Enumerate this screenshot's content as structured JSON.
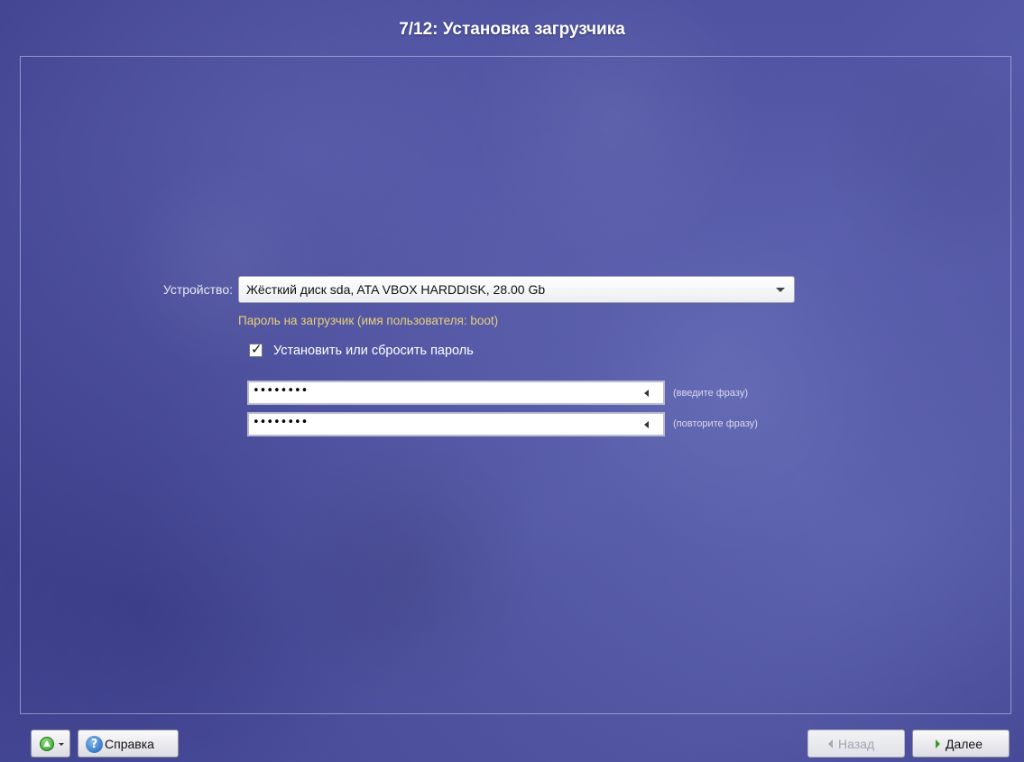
{
  "window": {
    "title": "7/12: Установка загрузчика"
  },
  "device": {
    "label": "Устройство:",
    "selected": "Жёсткий диск sda, ATA VBOX HARDDISK, 28.00 Gb"
  },
  "bootloader_password": {
    "section_label": "Пароль на загрузчик (имя пользователя: boot)",
    "checkbox_label": "Установить или сбросить пароль",
    "checkbox_checked": true,
    "checkbox_mark": "✓",
    "password_value": "••••••••",
    "password_hint": "(введите фразу)",
    "confirm_value": "••••••••",
    "confirm_hint": "(повторите фразу)"
  },
  "footer": {
    "menu_icon": "up-arrow-icon",
    "help_label": "Справка",
    "help_icon_glyph": "?",
    "back_label": "Назад",
    "back_enabled": false,
    "next_label": "Далее"
  },
  "colors": {
    "background": "#4a4d9c",
    "section_label": "#e9cf7a",
    "next_arrow": "#3a9a22"
  }
}
